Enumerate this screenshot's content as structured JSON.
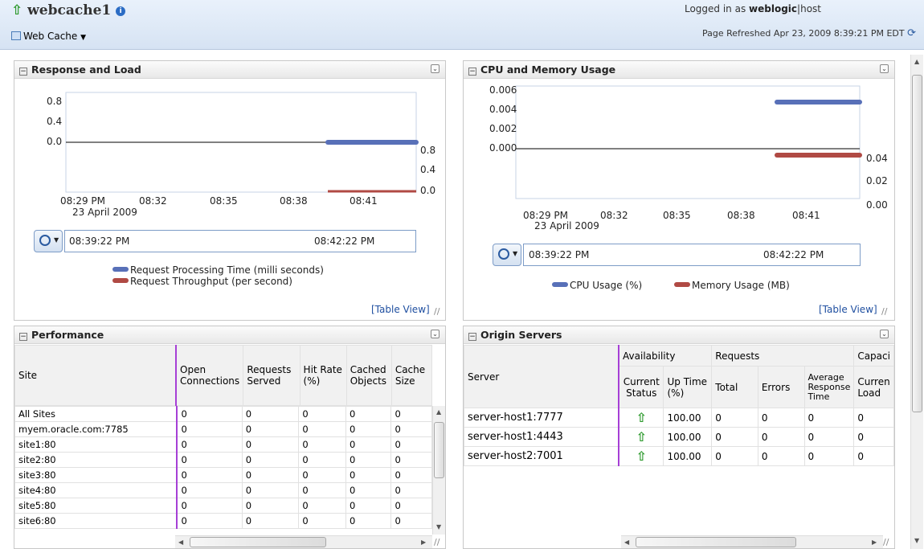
{
  "header": {
    "title": "webcache1",
    "info_icon": "i",
    "menu_label": "Web Cache",
    "logged_in_prefix": "Logged in as",
    "user": "weblogic",
    "host": "host",
    "refreshed": "Page Refreshed Apr 23, 2009 8:39:21 PM EDT"
  },
  "response_load": {
    "title": "Response and Load",
    "y_left": [
      "0.8",
      "0.4",
      "0.0"
    ],
    "y_right": [
      "0.8",
      "0.4",
      "0.0"
    ],
    "x_ticks": [
      "08:29 PM",
      "08:32",
      "08:35",
      "08:38",
      "08:41"
    ],
    "date": "23 April 2009",
    "range_start": "08:39:22 PM",
    "range_end": "08:42:22 PM",
    "legend": [
      "Request Processing Time (milli seconds)",
      "Request Throughput (per second)"
    ],
    "table_view": "[Table View]"
  },
  "cpu_memory": {
    "title": "CPU and Memory Usage",
    "y_left": [
      "0.006",
      "0.004",
      "0.002",
      "0.000"
    ],
    "y_right": [
      "0.04",
      "0.02",
      "0.00"
    ],
    "x_ticks": [
      "08:29 PM",
      "08:32",
      "08:35",
      "08:38",
      "08:41"
    ],
    "date": "23 April 2009",
    "range_start": "08:39:22 PM",
    "range_end": "08:42:22 PM",
    "legend": [
      "CPU Usage (%)",
      "Memory Usage (MB)"
    ],
    "table_view": "[Table View]"
  },
  "performance": {
    "title": "Performance",
    "columns": [
      "Site",
      "Open Connections",
      "Requests Served",
      "Hit Rate (%)",
      "Cached Objects",
      "Cache Size"
    ],
    "rows": [
      [
        "All Sites",
        "0",
        "0",
        "0",
        "0",
        "0"
      ],
      [
        "myem.oracle.com:7785",
        "0",
        "0",
        "0",
        "0",
        "0"
      ],
      [
        "site1:80",
        "0",
        "0",
        "0",
        "0",
        "0"
      ],
      [
        "site2:80",
        "0",
        "0",
        "0",
        "0",
        "0"
      ],
      [
        "site3:80",
        "0",
        "0",
        "0",
        "0",
        "0"
      ],
      [
        "site4:80",
        "0",
        "0",
        "0",
        "0",
        "0"
      ],
      [
        "site5:80",
        "0",
        "0",
        "0",
        "0",
        "0"
      ],
      [
        "site6:80",
        "0",
        "0",
        "0",
        "0",
        "0"
      ]
    ]
  },
  "origin": {
    "title": "Origin Servers",
    "group_availability": "Availability",
    "group_requests": "Requests",
    "group_capacity": "Capaci",
    "col_server": "Server",
    "col_status": "Current Status",
    "col_uptime": "Up Time (%)",
    "col_total": "Total",
    "col_errors": "Errors",
    "col_avg": "Average Response Time",
    "col_load": "Curren Load",
    "rows": [
      {
        "server": "server-host1:7777",
        "uptime": "100.00",
        "total": "0",
        "errors": "0",
        "avg": "0",
        "load": "0"
      },
      {
        "server": "server-host1:4443",
        "uptime": "100.00",
        "total": "0",
        "errors": "0",
        "avg": "0",
        "load": "0"
      },
      {
        "server": "server-host2:7001",
        "uptime": "100.00",
        "total": "0",
        "errors": "0",
        "avg": "0",
        "load": "0"
      }
    ]
  },
  "colors": {
    "series_blue": "#5870b8",
    "series_red": "#b04a44",
    "accent": "#8a2be2"
  }
}
